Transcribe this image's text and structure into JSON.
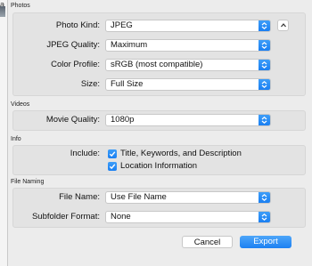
{
  "backdrop": {
    "glyph": "a"
  },
  "sections": {
    "photos": "Photos",
    "videos": "Videos",
    "info": "Info",
    "file_naming": "File Naming"
  },
  "photos": {
    "kind_label": "Photo Kind:",
    "kind_value": "JPEG",
    "quality_label": "JPEG Quality:",
    "quality_value": "Maximum",
    "profile_label": "Color Profile:",
    "profile_value": "sRGB (most compatible)",
    "size_label": "Size:",
    "size_value": "Full Size"
  },
  "videos": {
    "quality_label": "Movie Quality:",
    "quality_value": "1080p"
  },
  "info": {
    "include_label": "Include:",
    "opt1": "Title, Keywords, and Description",
    "opt2": "Location Information"
  },
  "file_naming": {
    "name_label": "File Name:",
    "name_value": "Use File Name",
    "subfolder_label": "Subfolder Format:",
    "subfolder_value": "None"
  },
  "buttons": {
    "cancel": "Cancel",
    "export": "Export"
  },
  "colors": {
    "accent": "#1a7ff2",
    "panel": "#e3e3e3",
    "sheet": "#ececec"
  },
  "icons": {
    "popup_arrows": "up-down-chevron-icon",
    "collapse": "chevron-up-icon",
    "checkbox": "checkmark-icon"
  }
}
